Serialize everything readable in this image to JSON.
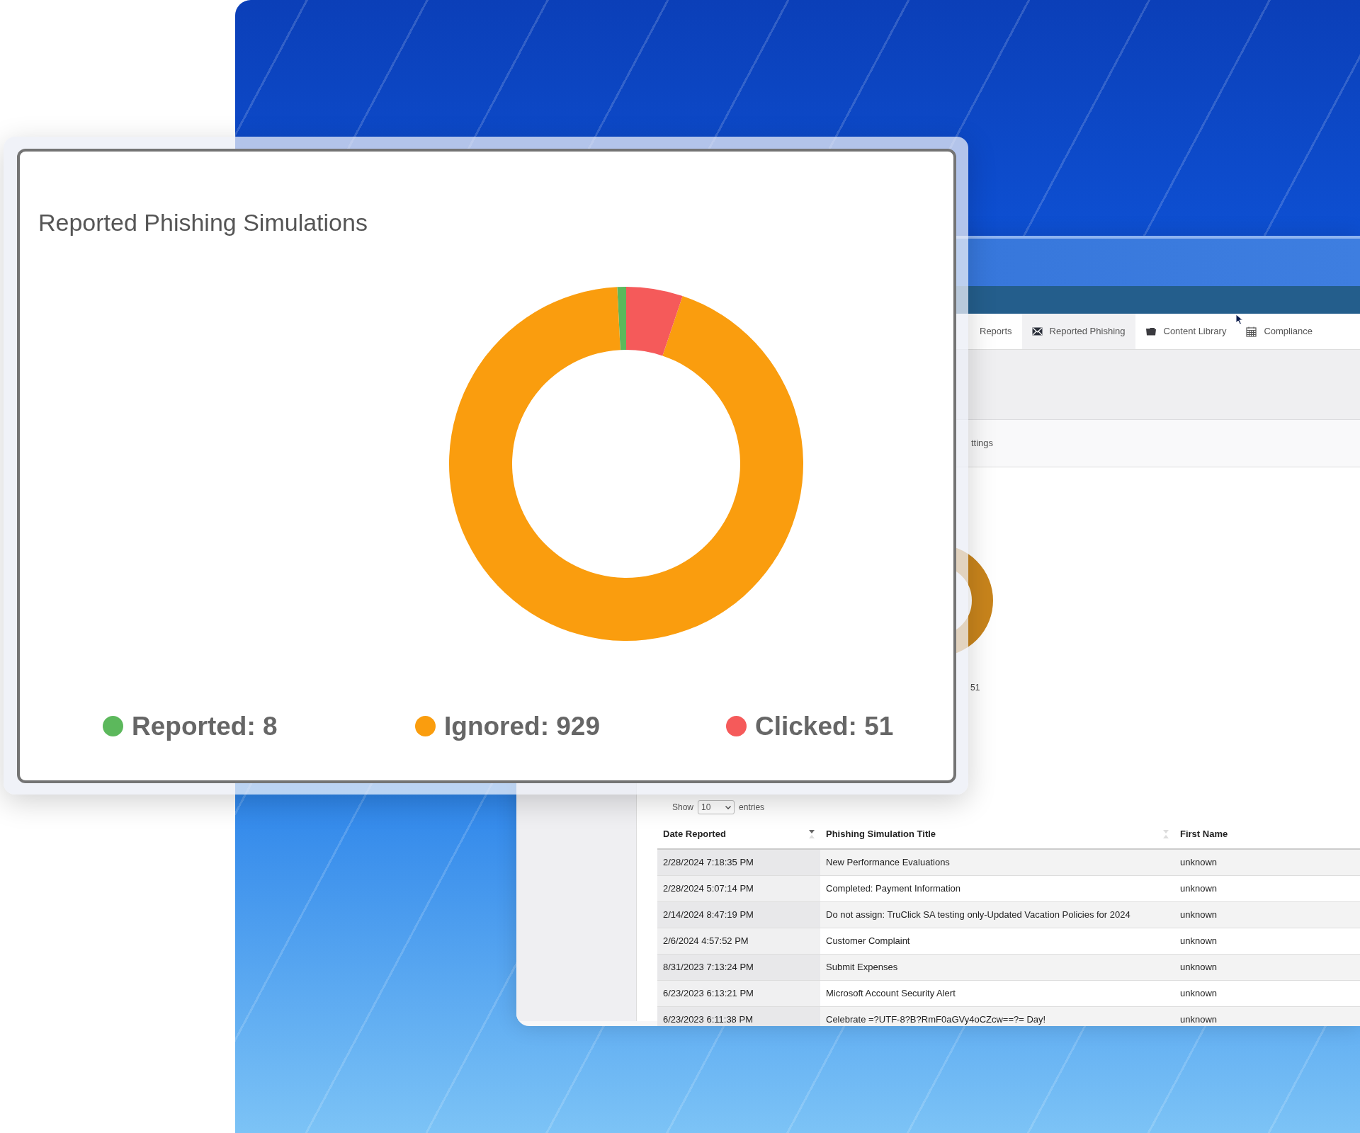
{
  "card": {
    "chart_data": {
      "type": "donut",
      "title": "Reported Phishing Simulations",
      "values": [
        0.81,
        94.03,
        5.16
      ]
    },
    "legend": [
      {
        "label": "Reported: 8",
        "color": "#5cb85c"
      },
      {
        "label": "Ignored: 929",
        "color": "#fa9d0e"
      },
      {
        "label": "Clicked: 51",
        "color": "#f55a5a"
      }
    ]
  },
  "app": {
    "nav": [
      {
        "label": "Reports",
        "selected": false
      },
      {
        "label": "Reported Phishing",
        "selected": true
      },
      {
        "label": "Content Library",
        "selected": false
      },
      {
        "label": "Compliance",
        "selected": false
      }
    ],
    "tab_strip_text": "ttings",
    "chart_label": "51",
    "show_entries": {
      "before": "Show",
      "value": "10",
      "after": "entries"
    },
    "table": {
      "columns": [
        {
          "label": "Date Reported",
          "sorted": true
        },
        {
          "label": "Phishing Simulation Title",
          "sorted": false
        },
        {
          "label": "First Name"
        }
      ],
      "rows": [
        [
          "2/28/2024 7:18:35 PM",
          "New Performance Evaluations",
          "unknown"
        ],
        [
          "2/28/2024 5:07:14 PM",
          "Completed: Payment Information",
          "unknown"
        ],
        [
          "2/14/2024 8:47:19 PM",
          "Do not assign: TruClick SA testing only-Updated Vacation Policies for 2024",
          "unknown"
        ],
        [
          "2/6/2024 4:57:52 PM",
          "Customer Complaint",
          "unknown"
        ],
        [
          "8/31/2023 7:13:24 PM",
          "Submit Expenses",
          "unknown"
        ],
        [
          "6/23/2023 6:13:21 PM",
          "Microsoft Account Security Alert",
          "unknown"
        ],
        [
          "6/23/2023 6:11:38 PM",
          "Celebrate =?UTF-8?B?RmF0aGVy4oCZcw==?= Day!",
          "unknown"
        ]
      ]
    }
  }
}
